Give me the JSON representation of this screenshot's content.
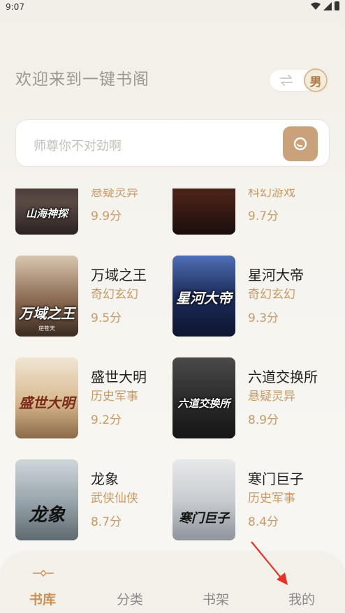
{
  "status_bar": {
    "time": "9:07"
  },
  "header": {
    "welcome_text": "欢迎来到一键书阁",
    "gender_label": "男"
  },
  "search": {
    "placeholder": "师尊你不对劲啊"
  },
  "books": [
    {
      "name": "",
      "genre": "悬疑灵异",
      "score": "9.9分",
      "cover_title": "山海神探",
      "cover_author": "",
      "cover_color": "#3b2f2c"
    },
    {
      "name": "",
      "genre": "科幻游戏",
      "score": "9.7分",
      "cover_title": "",
      "cover_author": "",
      "cover_color": "#2a1a16"
    },
    {
      "name": "万域之王",
      "genre": "奇幻玄幻",
      "score": "9.5分",
      "cover_title": "万域之王",
      "cover_author": "逆苍天",
      "cover_color": "#8a6a52"
    },
    {
      "name": "星河大帝",
      "genre": "奇幻玄幻",
      "score": "9.3分",
      "cover_title": "星河大帝",
      "cover_author": "",
      "cover_color": "#1c2b5a"
    },
    {
      "name": "盛世大明",
      "genre": "历史军事",
      "score": "9.2分",
      "cover_title": "盛世大明",
      "cover_author": "",
      "cover_color": "#d7b98f"
    },
    {
      "name": "六道交换所",
      "genre": "悬疑灵异",
      "score": "8.9分",
      "cover_title": "六道交换所",
      "cover_author": "",
      "cover_color": "#2c2c2c"
    },
    {
      "name": "龙象",
      "genre": "武侠仙侠",
      "score": "8.7分",
      "cover_title": "龙象",
      "cover_author": "",
      "cover_color": "#9aa6ad"
    },
    {
      "name": "寒门巨子",
      "genre": "历史军事",
      "score": "8.4分",
      "cover_title": "寒门巨子",
      "cover_author": "",
      "cover_color": "#c9cdd1"
    }
  ],
  "tabs": [
    {
      "label": "书库",
      "active": true
    },
    {
      "label": "分类",
      "active": false
    },
    {
      "label": "书架",
      "active": false
    },
    {
      "label": "我的",
      "active": false
    }
  ],
  "colors": {
    "accent": "#c8915a",
    "search_button": "#c9a27c",
    "annotation_arrow": "#e5332a"
  }
}
